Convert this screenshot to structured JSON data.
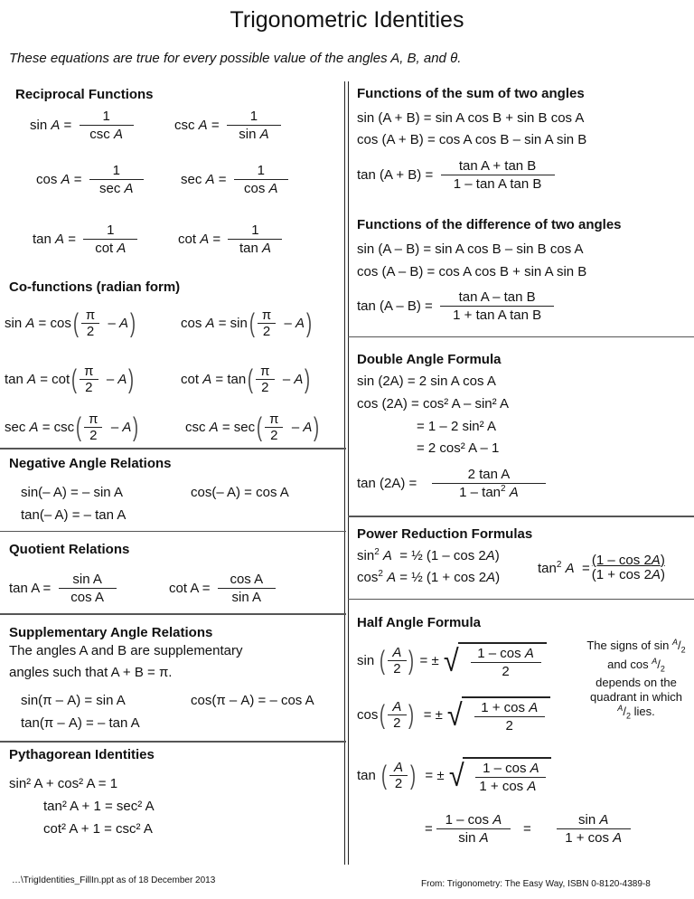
{
  "title": "Trigonometric Identities",
  "subtitle": "These equations are true for every possible value of the angles A, B, and θ.",
  "left": {
    "reciprocal": {
      "heading": "Reciprocal Functions",
      "items": [
        {
          "lhs": "sin",
          "num": "1",
          "den": "csc"
        },
        {
          "lhs": "csc",
          "num": "1",
          "den": "sin"
        },
        {
          "lhs": "cos",
          "num": "1",
          "den": "sec"
        },
        {
          "lhs": "sec",
          "num": "1",
          "den": "cos"
        },
        {
          "lhs": "tan",
          "num": "1",
          "den": "cot"
        },
        {
          "lhs": "cot",
          "num": "1",
          "den": "tan"
        }
      ]
    },
    "cofunctions": {
      "heading": "Co-functions (radian form)",
      "items": [
        {
          "lhs": "sin",
          "rhs": "cos"
        },
        {
          "lhs": "cos",
          "rhs": "sin"
        },
        {
          "lhs": "tan",
          "rhs": "cot"
        },
        {
          "lhs": "cot",
          "rhs": "tan"
        },
        {
          "lhs": "sec",
          "rhs": "csc"
        },
        {
          "lhs": "csc",
          "rhs": "sec"
        }
      ],
      "pi": "π",
      "two": "2",
      "minus_a": "– A"
    },
    "negative": {
      "heading": "Negative Angle Relations",
      "items": [
        "sin(– A) = – sin A",
        "cos(– A) = cos A",
        "tan(– A) = –  tan A"
      ]
    },
    "quotient": {
      "heading": "Quotient Relations",
      "items": [
        {
          "lhs": "tan A =",
          "num": "sin A",
          "den": "cos A"
        },
        {
          "lhs": "cot A =",
          "num": "cos A",
          "den": "sin A"
        }
      ]
    },
    "supplementary": {
      "heading": "Supplementary Angle Relations",
      "desc_line1": "The angles A and B are supplementary",
      "desc_line2": "angles such that A + B = π.",
      "items": [
        "sin(π – A) = sin A",
        "cos(π – A) = – cos A",
        "tan(π – A) = – tan A"
      ]
    },
    "pythagorean": {
      "heading": "Pythagorean Identities",
      "items": [
        "sin² A + cos² A = 1",
        "tan² A + 1 = sec² A",
        "cot² A + 1 = csc² A"
      ]
    }
  },
  "right": {
    "sum": {
      "heading": "Functions of the sum of two angles",
      "sin": "sin (A + B) = sin A cos B + sin B cos A",
      "cos": "cos (A + B) = cos A cos B – sin A sin B",
      "tan_lhs": "tan (A + B) =",
      "tan_num": "tan A + tan B",
      "tan_den": "1 – tan A tan B"
    },
    "difference": {
      "heading": "Functions of the difference of two angles",
      "sin": "sin (A – B) = sin A cos B – sin B cos A",
      "cos": "cos (A – B) = cos A cos B + sin A sin B",
      "tan_lhs": "tan (A – B) =",
      "tan_num": "tan A – tan B",
      "tan_den": "1 + tan A tan B"
    },
    "double": {
      "heading": "Double Angle Formula",
      "sin": "sin (2A) = 2 sin A cos A",
      "cos1": "cos (2A) = cos² A – sin² A",
      "cos2": "= 1 – 2 sin² A",
      "cos3": "= 2 cos² A – 1",
      "tan_lhs": "tan (2A) =",
      "tan_num": "2 tan A",
      "tan_den": "1 – tan² A"
    },
    "power": {
      "heading": "Power Reduction Formulas",
      "sin": "sin² A  = ½ (1 – cos 2A)",
      "cos": "cos² A = ½ (1 + cos 2A)",
      "tan_lhs": "tan² A  =",
      "tan_num": "(1 – cos 2A)",
      "tan_den": "(1 + cos 2A)"
    },
    "half": {
      "heading": "Half Angle Formula",
      "sin_lhs": "sin",
      "cos_lhs": "cos",
      "tan_lhs": "tan",
      "a": "A",
      "two": "2",
      "pm": "= ±",
      "sin_num": "1 – cos A",
      "sin_den": "2",
      "cos_num": "1 + cos A",
      "cos_den": "2",
      "tan_num": "1 – cos A",
      "tan_den": "1 + cos A",
      "eq": "=",
      "alt1_num": "1 – cos A",
      "alt1_den": "sin A",
      "alt2_num": "sin A",
      "alt2_den": "1 + cos A",
      "note": "The signs of sin A/2 and cos A/2 depends on the quadrant in which A/2 lies."
    }
  },
  "footer": {
    "left": "…\\TrigIdentities_FillIn.ppt as of 18 December 2013",
    "right": "From: Trigonometry: The Easy Way, ISBN 0-8120-4389-8"
  }
}
